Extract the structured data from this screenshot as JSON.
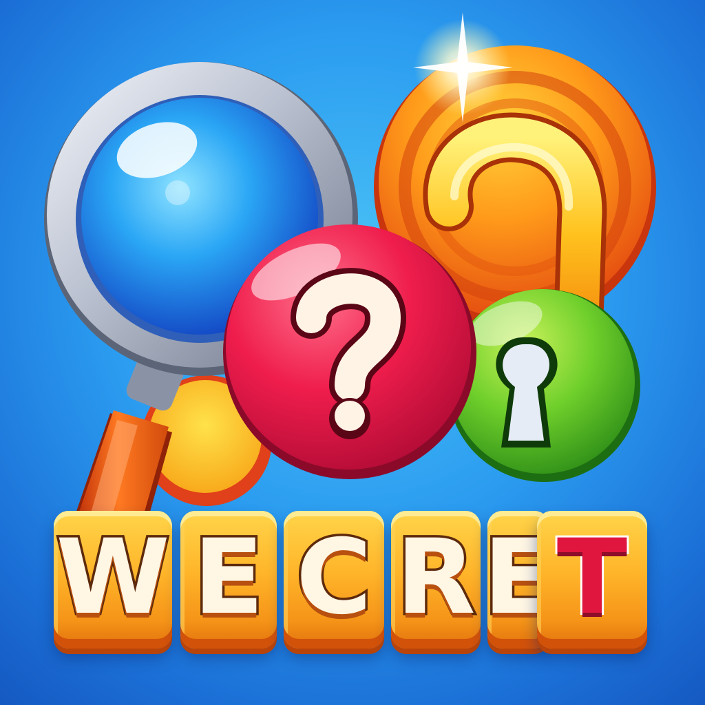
{
  "title_tiles": [
    {
      "letter": "W",
      "color": "#fff6e4"
    },
    {
      "letter": "E",
      "color": "#fff6e4"
    },
    {
      "letter": "C",
      "color": "#fff6e4"
    },
    {
      "letter": "R",
      "color": "#fff6e4"
    },
    {
      "letter": "E",
      "color": "#fff6e4"
    },
    {
      "letter": "T",
      "color": "#e0163f"
    }
  ],
  "icons": {
    "magnifier": "magnifying-glass-icon",
    "question_badge": "question-mark-icon",
    "big_question": "question-mark-icon",
    "lock": "keyhole-icon",
    "sparkle": "sparkle-icon"
  },
  "colors": {
    "background": "#2b9cf0",
    "tile": "#ffb52a",
    "question_ball": "#e8174a",
    "lock_ball": "#5cc62a",
    "lens": "#2a9af0",
    "orange_disc": "#f26b12"
  }
}
